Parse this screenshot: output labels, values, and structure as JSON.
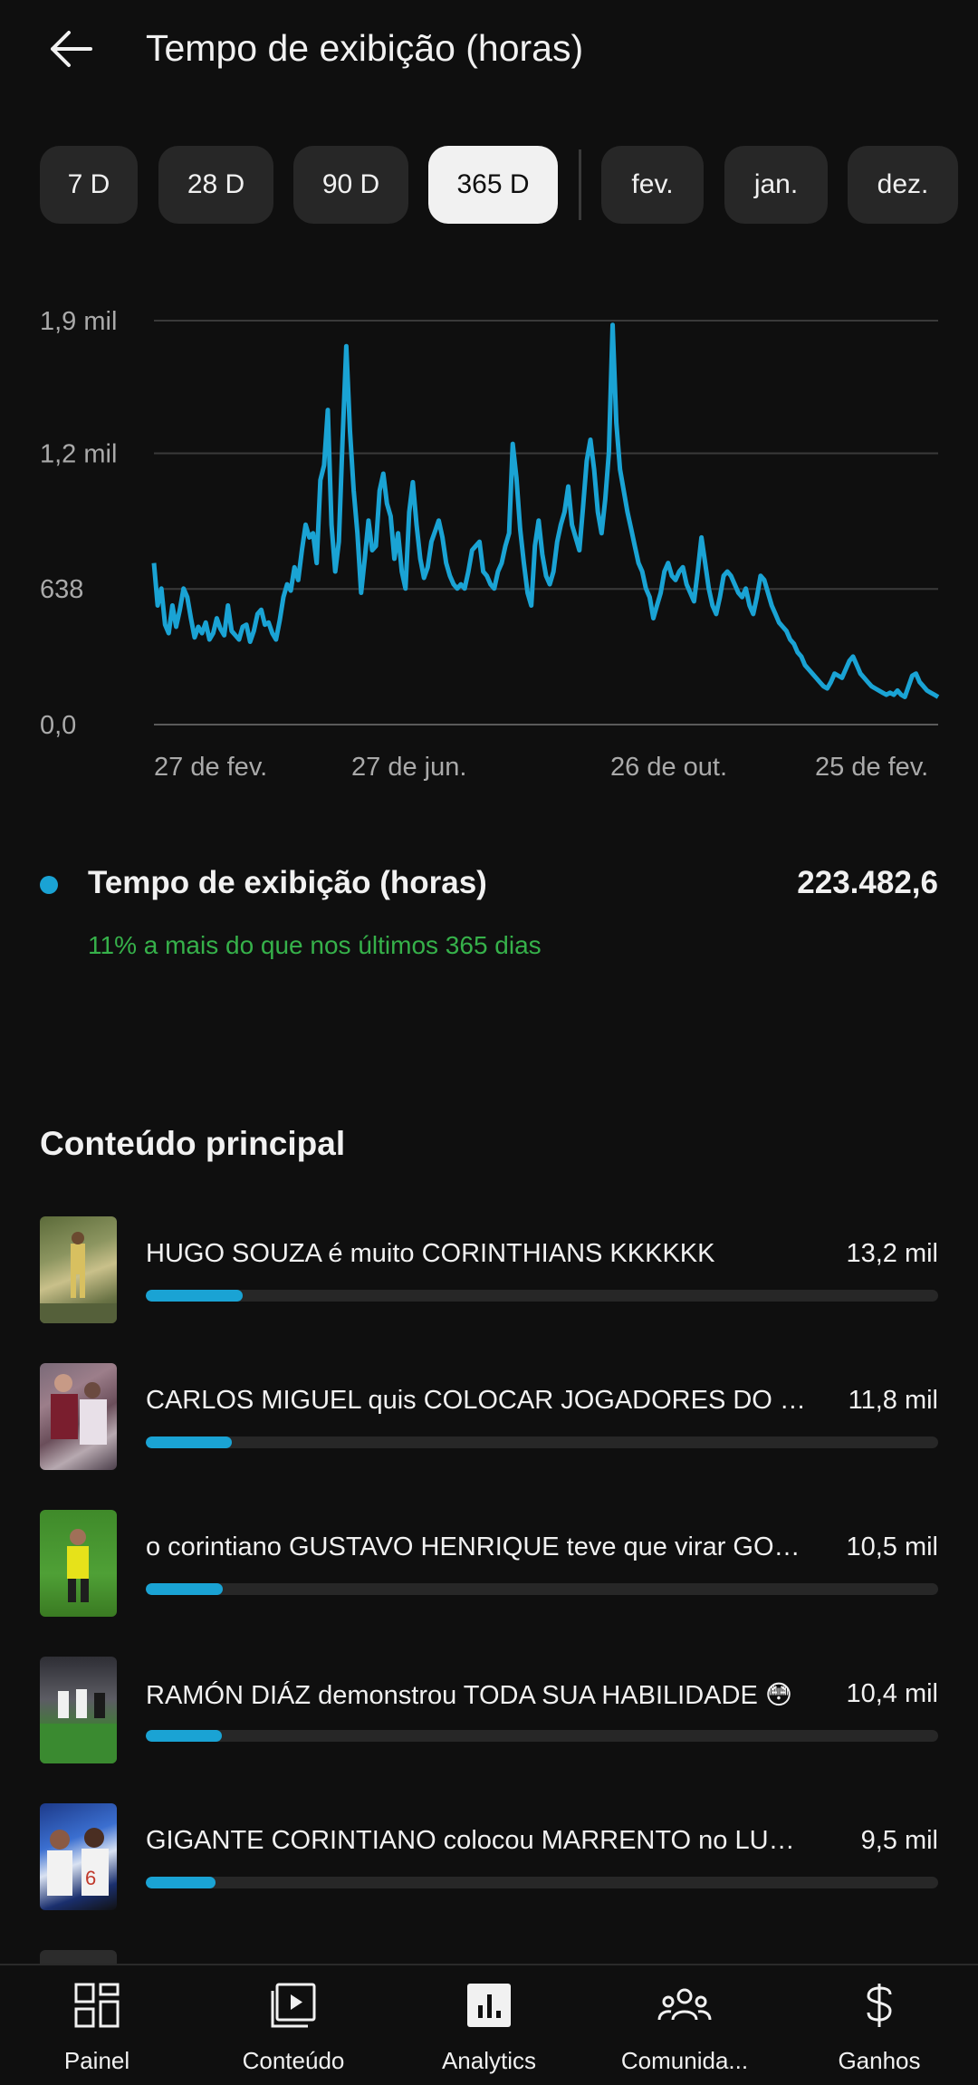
{
  "header": {
    "title": "Tempo de exibição (horas)",
    "back_icon": "arrow-left-icon"
  },
  "chips": [
    {
      "label": "7 D",
      "active": false
    },
    {
      "label": "28 D",
      "active": false
    },
    {
      "label": "90 D",
      "active": false
    },
    {
      "label": "365 D",
      "active": true
    },
    {
      "label": "fev.",
      "active": false
    },
    {
      "label": "jan.",
      "active": false
    },
    {
      "label": "dez.",
      "active": false
    }
  ],
  "chart_data": {
    "type": "line",
    "x_tick_labels": [
      "27 de fev.",
      "27 de jun.",
      "26 de out.",
      "25 de fev."
    ],
    "y_tick_labels": [
      "1,9 mil",
      "1,2 mil",
      "638",
      "0,0"
    ],
    "ylim": [
      0,
      1900
    ],
    "grid": true,
    "color": "#1aa3d4",
    "series": [
      {
        "values": [
          760,
          560,
          640,
          470,
          430,
          560,
          460,
          540,
          640,
          600,
          500,
          410,
          460,
          430,
          480,
          400,
          430,
          500,
          450,
          420,
          560,
          440,
          420,
          400,
          460,
          470,
          390,
          440,
          520,
          540,
          470,
          480,
          430,
          400,
          490,
          600,
          660,
          630,
          740,
          680,
          820,
          940,
          880,
          900,
          760,
          1150,
          1220,
          1480,
          940,
          720,
          860,
          1340,
          1780,
          1380,
          1100,
          900,
          620,
          780,
          960,
          820,
          840,
          1100,
          1180,
          1040,
          980,
          780,
          900,
          720,
          640,
          1000,
          1140,
          940,
          780,
          690,
          740,
          860,
          910,
          960,
          880,
          760,
          700,
          660,
          640,
          660,
          640,
          720,
          820,
          840,
          860,
          720,
          700,
          660,
          640,
          720,
          760,
          840,
          900,
          1320,
          1160,
          920,
          760,
          620,
          560,
          840,
          960,
          800,
          700,
          660,
          720,
          860,
          940,
          1000,
          1120,
          940,
          880,
          820,
          1020,
          1240,
          1340,
          1200,
          1000,
          900,
          1060,
          1280,
          1880,
          1420,
          1200,
          1100,
          1000,
          920,
          840,
          760,
          720,
          640,
          600,
          500,
          560,
          620,
          720,
          760,
          700,
          680,
          720,
          740,
          660,
          620,
          580,
          720,
          880,
          760,
          640,
          560,
          520,
          600,
          700,
          720,
          700,
          660,
          620,
          600,
          640,
          560,
          520,
          600,
          700,
          680,
          620,
          560,
          520,
          480,
          460,
          440,
          400,
          380,
          340,
          320,
          280,
          260,
          240,
          220,
          200,
          180,
          170,
          200,
          240,
          230,
          220,
          260,
          300,
          320,
          280,
          240,
          220,
          200,
          180,
          170,
          160,
          150,
          140,
          150,
          140,
          160,
          140,
          130,
          180,
          230,
          240,
          200,
          180,
          160,
          150,
          140,
          130
        ]
      }
    ]
  },
  "metric": {
    "label": "Tempo de exibição (horas)",
    "value": "223.482,6",
    "delta": "11% a mais do que nos últimos 365 dias",
    "dot_color": "#1aa3d4"
  },
  "top_content": {
    "title": "Conteúdo principal",
    "items": [
      {
        "title": "HUGO SOUZA é muito CORINTHIANS KKKKKK",
        "value": "13,2 mil",
        "fraction": 0.122
      },
      {
        "title": "CARLOS MIGUEL quis COLOCAR JOGADORES DO S...",
        "value": "11,8 mil",
        "fraction": 0.109
      },
      {
        "title": "o corintiano GUSTAVO HENRIQUE teve que virar GOL...",
        "value": "10,5 mil",
        "fraction": 0.097
      },
      {
        "title": "RAMÓN DIÁZ demonstrou TODA SUA HABILIDADE 😳",
        "value": "10,4 mil",
        "fraction": 0.096
      },
      {
        "title": "GIGANTE CORINTIANO colocou MARRENTO no LUGAR",
        "value": "9,5 mil",
        "fraction": 0.088
      }
    ]
  },
  "bottom_nav": [
    {
      "label": "Painel",
      "icon": "dashboard-icon",
      "active": false
    },
    {
      "label": "Conteúdo",
      "icon": "content-icon",
      "active": false
    },
    {
      "label": "Analytics",
      "icon": "analytics-icon",
      "active": true
    },
    {
      "label": "Comunida...",
      "icon": "community-icon",
      "active": false
    },
    {
      "label": "Ganhos",
      "icon": "dollar-icon",
      "active": false
    }
  ]
}
